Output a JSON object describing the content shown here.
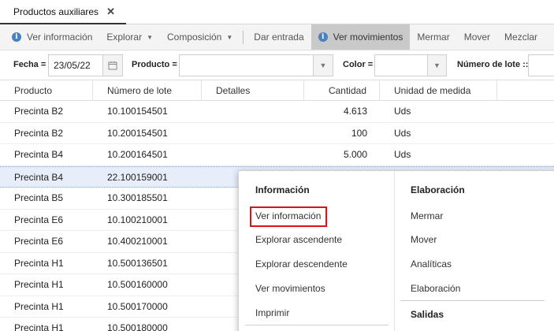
{
  "tab": {
    "label": "Productos auxiliares",
    "close": "✕"
  },
  "toolbar": {
    "ver_informacion": "Ver información",
    "explorar": "Explorar",
    "composicion": "Composición",
    "dar_entrada": "Dar entrada",
    "ver_movimientos": "Ver movimientos",
    "mermar": "Mermar",
    "mover": "Mover",
    "mezclar": "Mezclar"
  },
  "filters": {
    "fecha_label": "Fecha =",
    "fecha_value": "23/05/22",
    "producto_label": "Producto =",
    "producto_value": "",
    "color_label": "Color =",
    "color_value": "",
    "lote_label": "Número de lote ::",
    "lote_value": ""
  },
  "columns": {
    "producto": "Producto",
    "lote": "Número de lote",
    "detalles": "Detalles",
    "cantidad": "Cantidad",
    "unidad": "Unidad de medida"
  },
  "rows": [
    {
      "producto": "Precinta B2",
      "lote": "10.100154501",
      "cantidad": "4.613",
      "unidad": "Uds"
    },
    {
      "producto": "Precinta B2",
      "lote": "10.200154501",
      "cantidad": "100",
      "unidad": "Uds"
    },
    {
      "producto": "Precinta B4",
      "lote": "10.200164501",
      "cantidad": "5.000",
      "unidad": "Uds"
    },
    {
      "producto": "Precinta B4",
      "lote": "22.100159001",
      "cantidad": "",
      "unidad": ""
    },
    {
      "producto": "Precinta B5",
      "lote": "10.300185501",
      "cantidad": "",
      "unidad": ""
    },
    {
      "producto": "Precinta E6",
      "lote": "10.100210001",
      "cantidad": "",
      "unidad": ""
    },
    {
      "producto": "Precinta E6",
      "lote": "10.400210001",
      "cantidad": "",
      "unidad": ""
    },
    {
      "producto": "Precinta H1",
      "lote": "10.500136501",
      "cantidad": "",
      "unidad": ""
    },
    {
      "producto": "Precinta H1",
      "lote": "10.500160000",
      "cantidad": "",
      "unidad": ""
    },
    {
      "producto": "Precinta H1",
      "lote": "10.500170000",
      "cantidad": "",
      "unidad": ""
    },
    {
      "producto": "Precinta H1",
      "lote": "10.500180000",
      "cantidad": "",
      "unidad": ""
    }
  ],
  "context_menu": {
    "informacion_header": "Información",
    "ver_informacion": "Ver información",
    "explorar_ascendente": "Explorar ascendente",
    "explorar_descendente": "Explorar descendente",
    "ver_movimientos": "Ver movimientos",
    "imprimir": "Imprimir",
    "elaboracion_header": "Elaboración",
    "mermar": "Mermar",
    "mover": "Mover",
    "analiticas": "Analíticas",
    "elaboracion": "Elaboración",
    "salidas_header": "Salidas"
  },
  "colors": {
    "info_blue": "#4a7fc1",
    "highlight_red": "#d8141a",
    "selected_row": "#e7eefa"
  }
}
